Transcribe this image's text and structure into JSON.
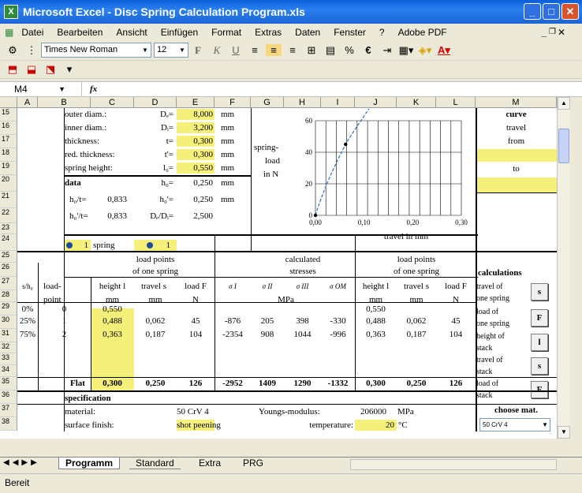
{
  "title": "Microsoft Excel - Disc Spring Calculation Program.xls",
  "menu": [
    "Datei",
    "Bearbeiten",
    "Ansicht",
    "Einfügen",
    "Format",
    "Extras",
    "Daten",
    "Fenster",
    "?",
    "Adobe PDF"
  ],
  "font": "Times New Roman",
  "fontsize": "12",
  "namebox": "M4",
  "fx": "fx",
  "cols": [
    "A",
    "B",
    "C",
    "D",
    "E",
    "F",
    "G",
    "H",
    "I",
    "J",
    "K",
    "L",
    "M"
  ],
  "rows": [
    "15",
    "16",
    "17",
    "18",
    "19",
    "20",
    "21",
    "22",
    "23",
    "24",
    "25",
    "26",
    "27",
    "28",
    "29",
    "30",
    "31",
    "32",
    "33",
    "34",
    "35",
    "36",
    "37",
    "38"
  ],
  "inputs": {
    "outer": {
      "label": "outer diam.:",
      "sym": "Dₑ=",
      "val": "8,000",
      "unit": "mm"
    },
    "inner": {
      "label": "inner diam.:",
      "sym": "Dᵢ=",
      "val": "3,200",
      "unit": "mm"
    },
    "thick": {
      "label": "thickness:",
      "sym": "t=",
      "val": "0,300",
      "unit": "mm"
    },
    "red": {
      "label": "red. thickness:",
      "sym": "t'=",
      "val": "0,300",
      "unit": "mm"
    },
    "height": {
      "label": "spring height:",
      "sym": "l₀=",
      "val": "0,550",
      "unit": "mm"
    }
  },
  "data": {
    "title": "data",
    "h0": "h₀=",
    "h0v": "0,250",
    "h0u": "mm",
    "h0t": "h₀/t=",
    "h0tv": "0,833",
    "h0b": "h₀'=",
    "h0bv": "0,250",
    "h0bu": "mm",
    "h0tb": "h₀'/t=",
    "h0tbv": "0,833",
    "dd": "Dₑ/Dᵢ=",
    "ddv": "2,500"
  },
  "stack": {
    "n1": "1",
    "spring": "spring",
    "n2": "1"
  },
  "chart": {
    "ylabel1": "spring-",
    "ylabel2": "load",
    "ylabel3": "in N",
    "yticks": [
      "60",
      "40",
      "20",
      "0"
    ],
    "xticks": [
      "0,00",
      "0,10",
      "0,20",
      "0,30"
    ],
    "xlabel": "travel in mm"
  },
  "chart_data": {
    "type": "line",
    "x": [
      0,
      0.062,
      0.187
    ],
    "y": [
      0,
      45,
      104
    ],
    "xlim": [
      0,
      0.3
    ],
    "ylim": [
      0,
      60
    ],
    "xlabel": "travel in mm",
    "ylabel": "spring- load in N"
  },
  "curve": {
    "title": "curve",
    "travel": "travel",
    "from": "from",
    "to": "to"
  },
  "table": {
    "lp1": "load points",
    "lp2": "of one spring",
    "cs1": "calculated",
    "cs2": "stresses",
    "sh": "s/h₀",
    "h1": "load-",
    "h1b": "point",
    "h2": "height l",
    "h2b": "mm",
    "h3": "travel s",
    "h3b": "mm",
    "h4": "load F",
    "h4b": "N",
    "s1": "σ I",
    "s2": "σ II",
    "s3": "σ III",
    "s4": "σ OM",
    "mpa": "MPa",
    "rows": [
      {
        "sh": "0%",
        "p": "0",
        "l": "0,550",
        "s": "",
        "f": "",
        "a": "",
        "b": "",
        "c": "",
        "d": "",
        "l2": "0,550",
        "s2": "",
        "f2": ""
      },
      {
        "sh": "25%",
        "p": "1",
        "l": "0,488",
        "s": "0,062",
        "f": "45",
        "a": "-876",
        "b": "205",
        "c": "398",
        "d": "-330",
        "l2": "0,488",
        "s2": "0,062",
        "f2": "45"
      },
      {
        "sh": "75%",
        "p": "2",
        "l": "0,363",
        "s": "0,187",
        "f": "104",
        "a": "-2354",
        "b": "908",
        "c": "1044",
        "d": "-996",
        "l2": "0,363",
        "s2": "0,187",
        "f2": "104"
      }
    ],
    "flat": {
      "p": "Flat",
      "l": "0,300",
      "s": "0,250",
      "f": "126",
      "a": "-2952",
      "b": "1409",
      "c": "1290",
      "d": "-1332",
      "l2": "0,300",
      "s2": "0,250",
      "f2": "126"
    }
  },
  "calc": {
    "title": "calculations",
    "t1a": "travel of",
    "t1b": "one spring",
    "b1": "s",
    "t2a": "load of",
    "t2b": "one spring",
    "b2": "F",
    "t3a": "height of",
    "t3b": "stack",
    "b3": "l",
    "t4a": "travel of",
    "t4b": "stack",
    "b4": "s",
    "t5a": "load of",
    "t5b": "stack",
    "b5": "F"
  },
  "spec": {
    "title": "specification",
    "mat": "material:",
    "matv": "50 CrV 4",
    "young": "Youngs-modulus:",
    "youngv": "206000",
    "youngu": "MPa",
    "surf": "surface finish:",
    "surfv": "shot peening",
    "temp": "temperature:",
    "tempv": "20",
    "tempu": "°C",
    "choose": "choose mat.",
    "choosev": "50 CrV 4"
  },
  "tabs": [
    "Programm",
    "Standard",
    "Extra",
    "PRG"
  ],
  "status": "Bereit"
}
